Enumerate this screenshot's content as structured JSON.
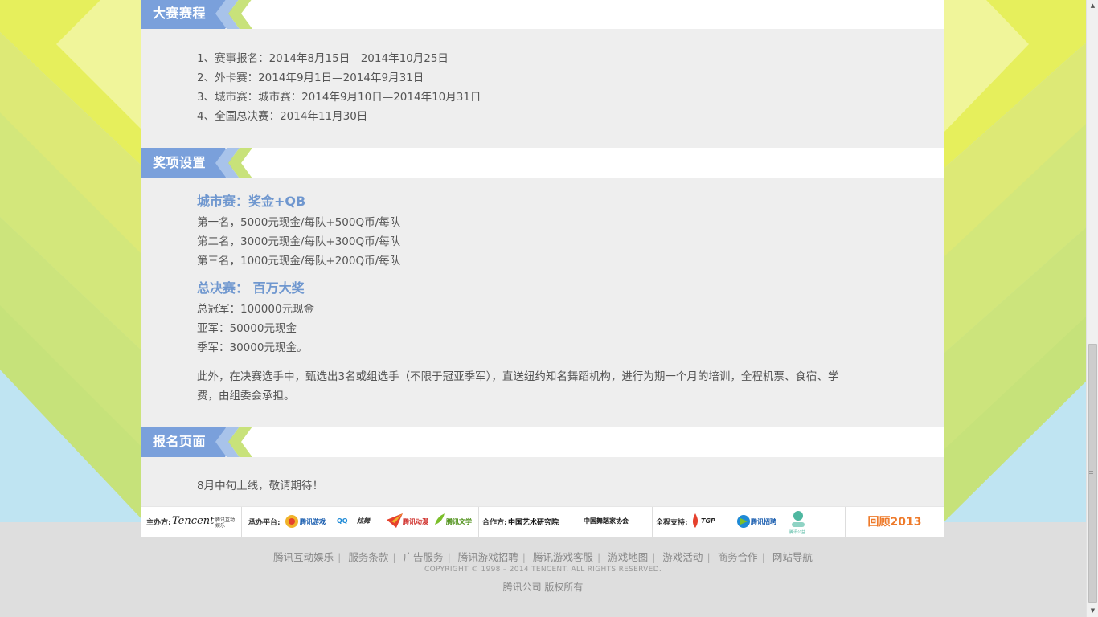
{
  "sections": {
    "schedule": {
      "title": "大赛赛程",
      "items": [
        "1、赛事报名：2014年8月15日—2014年10月25日",
        "2、外卡赛：2014年9月1日—2014年9月31日",
        "3、城市赛：城市赛：2014年9月10日—2014年10月31日",
        "4、全国总决赛：2014年11月30日"
      ]
    },
    "awards": {
      "title": "奖项设置",
      "city": {
        "heading": "城市赛：奖金+QB",
        "lines": [
          "第一名，5000元现金/每队+500Q币/每队",
          "第二名，3000元现金/每队+300Q币/每队",
          "第三名，1000元现金/每队+200Q币/每队"
        ]
      },
      "final": {
        "heading": "总决赛： 百万大奖",
        "lines": [
          "总冠军：100000元现金",
          "亚军：50000元现金",
          "季军：30000元现金。"
        ]
      },
      "extra_line1": "此外，在决赛选手中，甄选出3名或组选手（不限于冠亚季军），直送纽约知名舞蹈机构，进行为期一个月的培训，全程机票、食宿、学",
      "extra_line2": "费，由组委会承担。"
    },
    "signup": {
      "title": "报名页面",
      "text": "8月中旬上线，敬请期待！"
    }
  },
  "sponsors": {
    "host_label": "主办方:",
    "host_logo": "Tencent",
    "host_logo_sub": "腾讯互动娱乐",
    "platform_label": "承办平台:",
    "platform_logos": [
      "腾讯游戏",
      "QQ",
      "炫舞",
      "腾讯动漫",
      "腾讯文学"
    ],
    "partner_label": "合作方:",
    "partner_logos": [
      "中国艺术研究院",
      "中国舞蹈家协会"
    ],
    "support_label": "全程支持:",
    "support_logos": [
      "TGP",
      "腾讯招聘",
      "腾讯公益"
    ],
    "review_link": "回顾2013"
  },
  "footer": {
    "links": [
      "腾讯互动娱乐",
      "服务条款",
      "广告服务",
      "腾讯游戏招聘",
      "腾讯游戏客服",
      "游戏地图",
      "游戏活动",
      "商务合作",
      "网站导航"
    ],
    "copyright": "COPYRIGHT © 1998 – 2014 TENCENT. ALL RIGHTS RESERVED.",
    "rights": "腾讯公司 版权所有"
  },
  "colors": {
    "tab_blue": "#7aa0db",
    "tab_green": "#c8e27a",
    "heading_blue": "#6f97cf",
    "review_orange": "#ee7a2a"
  }
}
